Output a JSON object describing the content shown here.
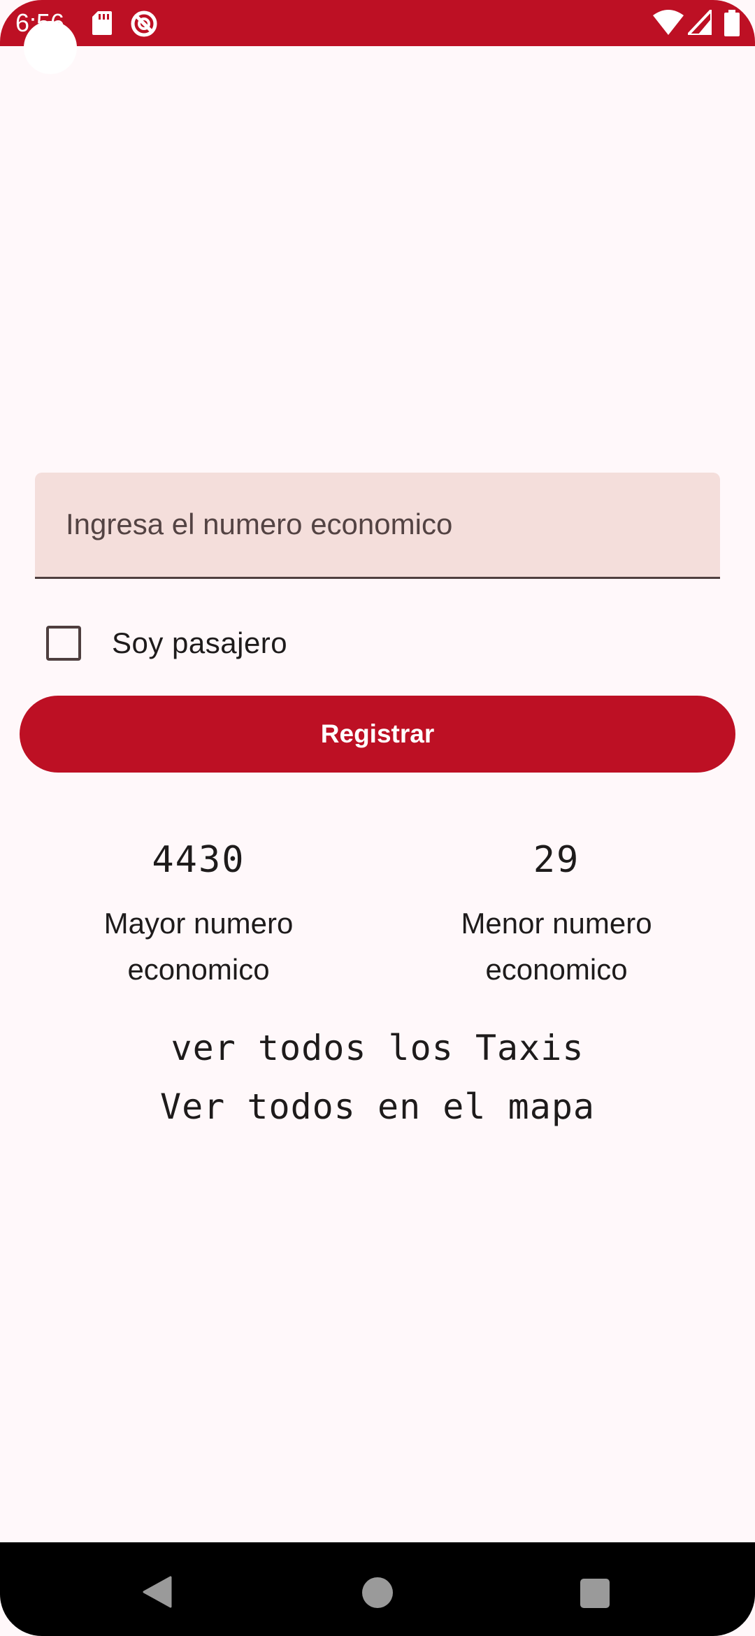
{
  "status_bar": {
    "time": "6:56",
    "icons": [
      "sd-card-icon",
      "do-not-disturb-icon",
      "wifi-icon",
      "signal-icon",
      "battery-icon"
    ]
  },
  "form": {
    "input_placeholder": "Ingresa el numero economico",
    "input_value": "",
    "checkbox_label": "Soy pasajero",
    "checkbox_checked": false,
    "register_label": "Registrar"
  },
  "stats": {
    "max_value": "4430",
    "max_label": "Mayor numero economico",
    "min_value": "29",
    "min_label": "Menor numero economico"
  },
  "links": {
    "all_taxis": "ver todos los Taxis",
    "all_map": "Ver todos en el mapa"
  },
  "nav": {
    "buttons": [
      "back-icon",
      "home-icon",
      "recents-icon"
    ]
  },
  "colors": {
    "primary": "#bd1024",
    "background": "#fff8fa",
    "field_background": "#f4dedb",
    "text": "#1e1b1b"
  }
}
